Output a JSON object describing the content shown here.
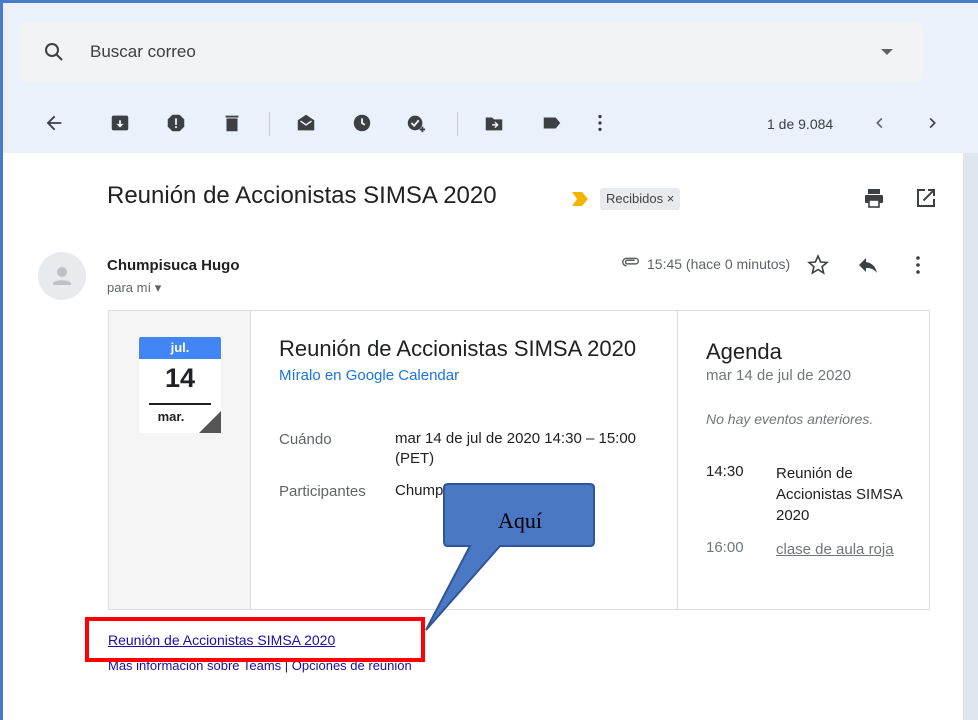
{
  "search": {
    "placeholder": "Buscar correo"
  },
  "toolbar": {
    "icons": [
      "back-arrow-icon",
      "archive-icon",
      "report-spam-icon",
      "delete-icon",
      "mark-unread-icon",
      "snooze-icon",
      "add-task-icon",
      "move-to-icon",
      "labels-icon",
      "more-vert-icon"
    ],
    "counter": "1 de 9.084"
  },
  "email": {
    "subject": "Reunión de Accionistas SIMSA 2020",
    "label": "Recibidos",
    "label_close": "×",
    "sender": "Chumpisuca Hugo",
    "to": "para mí",
    "time": "15:45 (hace 0 minutos)"
  },
  "invite": {
    "month": "jul.",
    "day": "14",
    "weekday": "mar.",
    "title": "Reunión de Accionistas SIMSA 2020",
    "calendar_link": "Míralo en Google Calendar",
    "when_label": "Cuándo",
    "when_value": "mar 14 de jul de 2020 14:30 – 15:00 (PET)",
    "participants_label": "Participantes",
    "participants_value": "Chumpi"
  },
  "agenda": {
    "title": "Agenda",
    "date": "mar 14 de jul de 2020",
    "none": "No hay eventos anteriores.",
    "events": [
      {
        "time": "14:30",
        "name": "Reunión de Accionistas SIMSA 2020"
      },
      {
        "time": "16:00",
        "name": "clase de aula roja"
      }
    ]
  },
  "body": {
    "meeting_link": "Reunión de Accionistas SIMSA 2020",
    "teams_info": "Más información sobre Teams | Opciones de reunión"
  },
  "annotation": {
    "callout": "Aquí"
  },
  "colors": {
    "accent": "#4285f4",
    "highlight": "#ff0000",
    "callout_fill": "#4a78c4",
    "label_arrow": "#f4b400"
  }
}
